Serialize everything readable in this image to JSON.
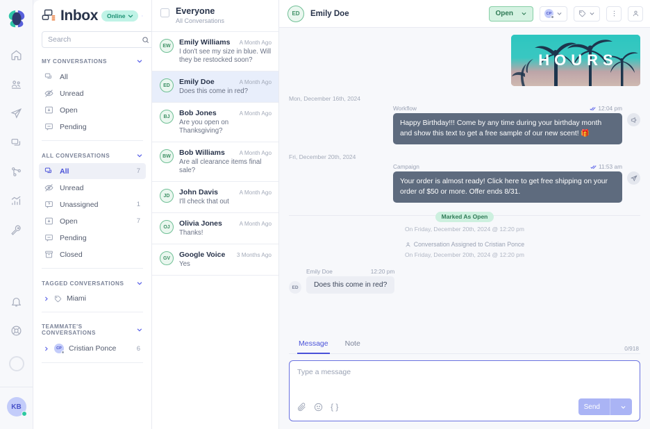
{
  "rail": {
    "logo": "brand-logo",
    "icons": [
      {
        "name": "home-icon",
        "label": "Home"
      },
      {
        "name": "contacts-icon",
        "label": "Contacts"
      },
      {
        "name": "campaigns-icon",
        "label": "Campaigns"
      },
      {
        "name": "inbox-icon",
        "label": "Inbox"
      },
      {
        "name": "workflows-icon",
        "label": "Workflows"
      },
      {
        "name": "analytics-icon",
        "label": "Analytics"
      },
      {
        "name": "settings-wrench-icon",
        "label": "Settings"
      }
    ],
    "bell": "notifications-icon",
    "lifebuoy": "support-icon",
    "user_initials": "KB"
  },
  "sidebar": {
    "title": "Inbox",
    "status": "Online",
    "help_icon": "help-icon",
    "search": {
      "placeholder": "Search",
      "value": ""
    },
    "compose_label": "compose-icon",
    "sections": [
      {
        "title": "MY CONVERSATIONS",
        "items": [
          {
            "label": "All",
            "icon": "chat-bubbles-icon",
            "count": "",
            "active": false
          },
          {
            "label": "Unread",
            "icon": "eye-off-icon",
            "count": "",
            "active": false
          },
          {
            "label": "Open",
            "icon": "inbox-down-icon",
            "count": "",
            "active": false
          },
          {
            "label": "Pending",
            "icon": "comment-icon",
            "count": "",
            "active": false
          }
        ]
      },
      {
        "title": "ALL CONVERSATIONS",
        "items": [
          {
            "label": "All",
            "icon": "chat-bubbles-icon",
            "count": "7",
            "active": true
          },
          {
            "label": "Unread",
            "icon": "eye-off-icon",
            "count": "",
            "active": false
          },
          {
            "label": "Unassigned",
            "icon": "question-box-icon",
            "count": "1",
            "active": false
          },
          {
            "label": "Open",
            "icon": "inbox-down-icon",
            "count": "7",
            "active": false
          },
          {
            "label": "Pending",
            "icon": "comment-icon",
            "count": "",
            "active": false
          },
          {
            "label": "Closed",
            "icon": "archive-icon",
            "count": "",
            "active": false
          }
        ]
      }
    ],
    "tagged": {
      "title": "TAGGED CONVERSATIONS",
      "items": [
        {
          "label": "Miami",
          "icon": "tag-icon",
          "count": ""
        }
      ]
    },
    "teammates": {
      "title": "TEAMMATE'S CONVERSATIONS",
      "items": [
        {
          "label": "Cristian Ponce",
          "initials": "CP",
          "count": "6"
        }
      ]
    }
  },
  "conversation_list": {
    "header": {
      "title": "Everyone",
      "subtitle": "All Conversations"
    },
    "items": [
      {
        "initials": "EW",
        "name": "Emily Williams",
        "time": "A Month Ago",
        "snippet": "I don't see my size in blue. Will they be restocked soon?",
        "selected": false
      },
      {
        "initials": "ED",
        "name": "Emily Doe",
        "time": "A Month Ago",
        "snippet": "Does this come in red?",
        "selected": true
      },
      {
        "initials": "BJ",
        "name": "Bob Jones",
        "time": "A Month Ago",
        "snippet": "Are you open on Thanksgiving?",
        "selected": false
      },
      {
        "initials": "BW",
        "name": "Bob Williams",
        "time": "A Month Ago",
        "snippet": "Are all clearance items final sale?",
        "selected": false
      },
      {
        "initials": "JD",
        "name": "John Davis",
        "time": "A Month Ago",
        "snippet": "I'll check that out",
        "selected": false
      },
      {
        "initials": "OJ",
        "name": "Olivia Jones",
        "time": "A Month Ago",
        "snippet": "Thanks!",
        "selected": false
      },
      {
        "initials": "GV",
        "name": "Google Voice",
        "time": "3 Months Ago",
        "snippet": "Yes",
        "selected": false
      }
    ]
  },
  "main": {
    "header": {
      "avatar_initials": "ED",
      "contact_name": "Emily Doe",
      "status_label": "Open",
      "assignee_initials": "CP",
      "tag_icon": "tag-icon",
      "more_icon": "more-vertical-icon",
      "contact_icon": "contact-panel-icon"
    },
    "banner": {
      "text": "HOURS",
      "alt": "palm-trees-hours-image"
    },
    "thread": [
      {
        "type": "date",
        "label": "Mon, December 16th, 2024"
      },
      {
        "type": "outgoing",
        "sender": "Workflow",
        "time": "12:04 pm",
        "text": "Happy Birthday!!! Come by any time during your birthday month and show this text to get a free sample of our new scent! 🎁",
        "channel_icon": "megaphone-icon"
      },
      {
        "type": "date",
        "label": "Fri, December 20th, 2024"
      },
      {
        "type": "outgoing",
        "sender": "Campaign",
        "time": "11:53 am",
        "text": "Your order is almost ready! Click here to get free shipping on your order of $50 or more. Offer ends 8/31.",
        "channel_icon": "paper-plane-icon"
      },
      {
        "type": "system-pill",
        "label": "Marked As Open",
        "sub": "On Friday, December 20th, 2024 @ 12:20 pm"
      },
      {
        "type": "system-assign",
        "label": "Conversation Assigned to Cristian Ponce",
        "sub": "On Friday, December 20th, 2024 @ 12:20 pm"
      },
      {
        "type": "incoming",
        "avatar_initials": "ED",
        "sender": "Emily Doe",
        "time": "12:20 pm",
        "text": "Does this come in red?"
      }
    ],
    "composer": {
      "tabs": [
        {
          "label": "Message",
          "active": true
        },
        {
          "label": "Note",
          "active": false
        }
      ],
      "char_count": "0/918",
      "placeholder": "Type a message",
      "value": "",
      "tools": [
        "attachment-icon",
        "emoji-icon",
        "variable-icon"
      ],
      "send_label": "Send"
    }
  },
  "colors": {
    "accent": "#4a52d9",
    "green": "#2f7a56",
    "green_bg": "#d5f2e2",
    "bubble_out": "#5e6b7e",
    "teal": "#2ec6c0"
  }
}
